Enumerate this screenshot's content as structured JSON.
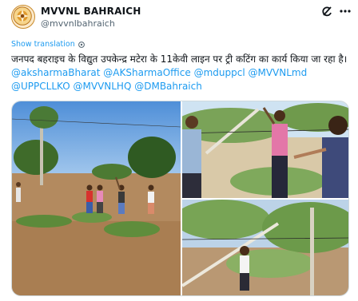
{
  "account": {
    "display_name": "MVVNL BAHRAICH",
    "handle": "@mvvnlbahraich"
  },
  "show_translation_label": "Show translation",
  "tweet": {
    "text_hindi": "जनपद बहराइच के विद्युत उपकेन्द्र मटेरा के 11केवी लाइन पर ट्री कटिंग का कार्य किया जा रहा है।",
    "mentions": [
      "@aksharmaBharat",
      "@AKSharmaOffice",
      "@mduppcl",
      "@MVVNLmd",
      "@UPPCLLKO",
      "@MVVNLHQ",
      "@DMBahraich"
    ]
  },
  "media": {
    "photos": [
      "workers-clearing-branches-field",
      "man-cutting-eucalyptus-branch",
      "fallen-branch-on-line"
    ]
  },
  "icons": {
    "grok": "grok-icon",
    "more": "more-icon",
    "translate": "translate-icon",
    "avatar": "logo-avatar"
  },
  "colors": {
    "accent": "#1d9bf0",
    "text": "#0f1419",
    "secondary": "#536471"
  }
}
